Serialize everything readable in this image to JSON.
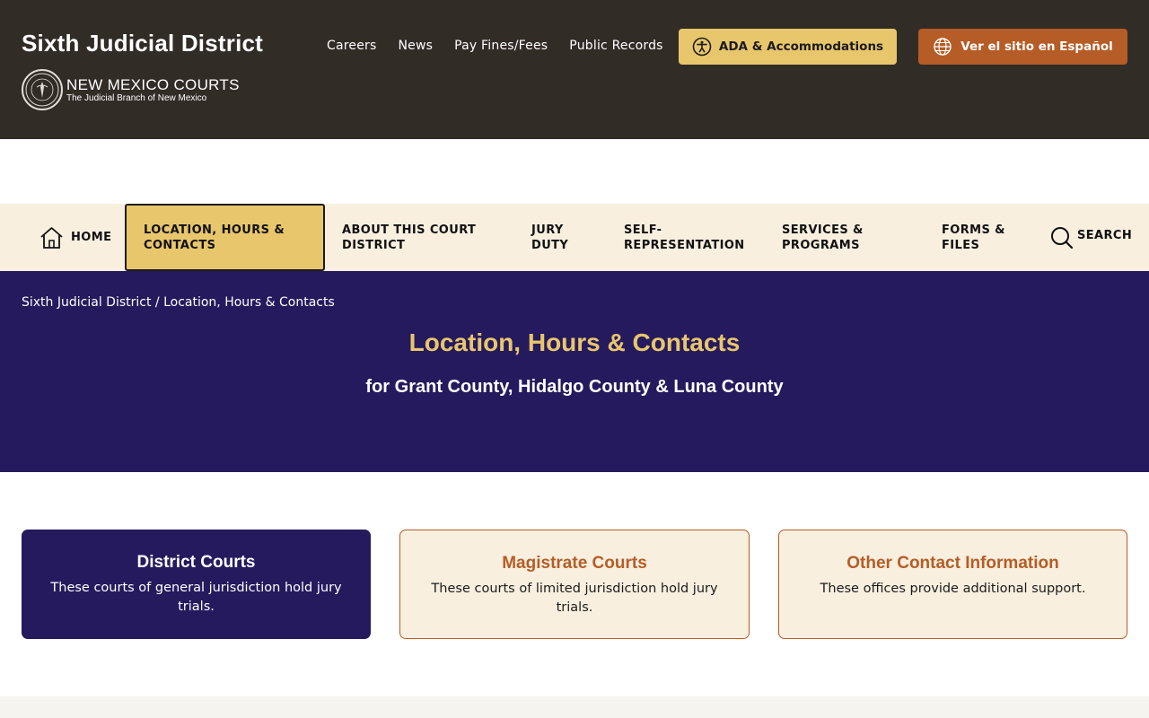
{
  "header": {
    "site_title": "Sixth Judicial District",
    "brand_main": "NEW MEXICO COURTS",
    "brand_sub": "The Judicial Branch of New Mexico",
    "seal_icon": "state-seal-icon",
    "utility_links": [
      "Careers",
      "News",
      "Pay Fines/Fees",
      "Public Records"
    ],
    "ada_button": {
      "label": "ADA & Accommodations",
      "icon": "accessibility-icon",
      "color": "#e8c66c"
    },
    "spanish_button": {
      "label": "Ver el sitio en Español",
      "icon": "globe-icon",
      "color": "#b65c26"
    },
    "background": "#322c27"
  },
  "nav": {
    "home": "HOME",
    "items": [
      "LOCATION, HOURS & CONTACTS",
      "ABOUT THIS COURT DISTRICT",
      "JURY DUTY",
      "SELF-REPRESENTATION",
      "SERVICES & PROGRAMS",
      "FORMS & FILES"
    ],
    "active_item": "LOCATION, HOURS & CONTACTS",
    "search": "SEARCH",
    "background": "#f8efdf",
    "active_color": "#e8c66c"
  },
  "hero": {
    "breadcrumb_root": "Sixth Judicial District",
    "breadcrumb_sep": "/",
    "breadcrumb_current": "Location, Hours & Contacts",
    "title": "Location, Hours & Contacts",
    "subtitle": "for Grant County, Hidalgo County & Luna County",
    "background": "#251a5e"
  },
  "cards": [
    {
      "title": "District Courts",
      "description": "These courts of general jurisdiction hold jury trials."
    },
    {
      "title": "Magistrate Courts",
      "description": "These courts of limited jurisdiction hold jury trials."
    },
    {
      "title": "Other Contact Information",
      "description": "These offices provide additional support."
    }
  ]
}
